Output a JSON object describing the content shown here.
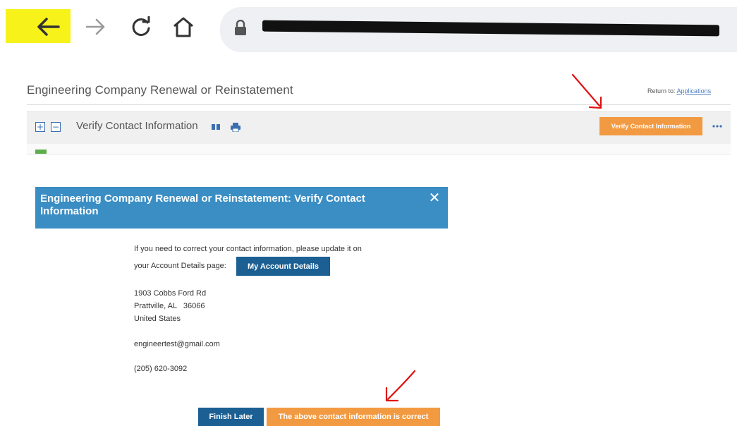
{
  "browser": {
    "back_icon": "back-arrow-icon",
    "forward_icon": "forward-arrow-icon",
    "reload_icon": "reload-icon",
    "home_icon": "home-icon",
    "lock_icon": "lock-icon"
  },
  "app": {
    "page_title": "Engineering Company Renewal or Reinstatement",
    "return_label": "Return to:",
    "return_link": "Applications",
    "section_title": "Verify Contact Information",
    "verify_button": "Verify Contact Information",
    "expand_symbol": "+",
    "collapse_symbol": "−"
  },
  "modal": {
    "title": "Engineering Company Renewal or Reinstatement: Verify Contact Information",
    "close_symbol": "✕",
    "instruction_line1": "If you need to correct your contact information, please update it on",
    "instruction_line2": "your Account Details page:",
    "account_button": "My Account Details",
    "address_line1": "1903 Cobbs Ford Rd",
    "address_line2": "Prattville, AL   36066",
    "address_line3": "United States",
    "email": "engineertest@gmail.com",
    "phone": "(205) 620-3092",
    "finish_button": "Finish Later",
    "correct_button": "The above contact information is correct"
  },
  "colors": {
    "highlight": "#f7f21a",
    "modal_header": "#3a8ec4",
    "primary_button": "#1b5f93",
    "orange_button": "#f29a42",
    "annotation": "#e01010"
  }
}
